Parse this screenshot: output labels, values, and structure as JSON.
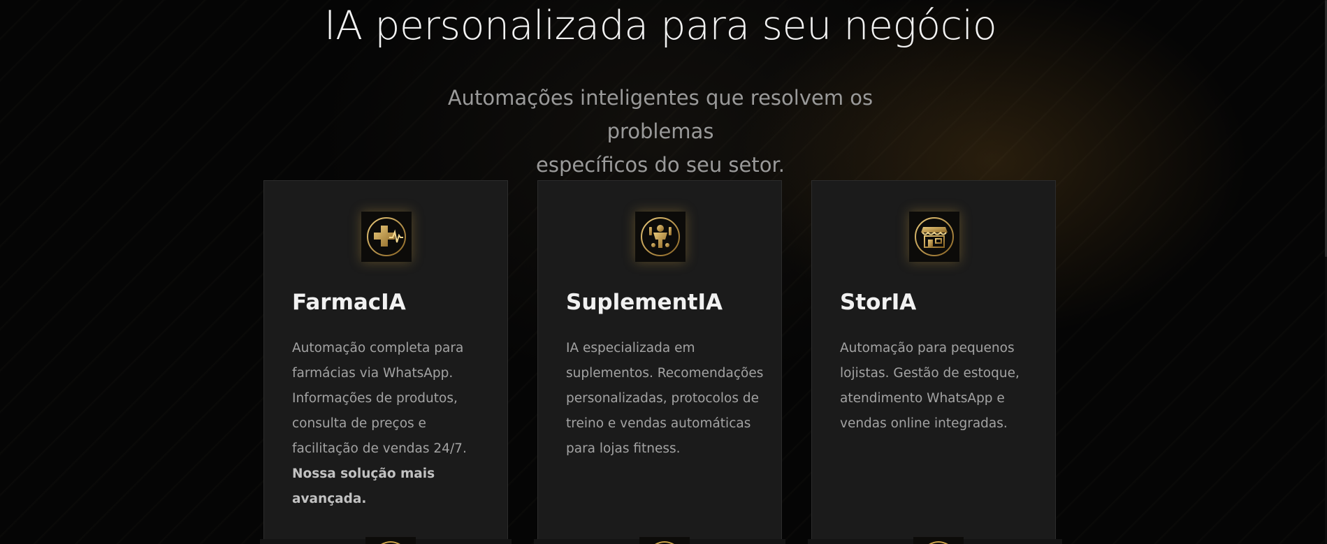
{
  "hero": {
    "title": "IA personalizada para seu negócio",
    "subtitle_line1": "Automações inteligentes que resolvem os problemas",
    "subtitle_line2": "específicos do seu setor."
  },
  "cards": [
    {
      "icon": "pharmacy-cross-icon",
      "name": "FarmacIA",
      "description": "Automação completa para farmácias via WhatsApp. Informações de produtos, consulta de preços e facilitação de vendas 24/7.",
      "highlight": "Nossa solução mais avançada."
    },
    {
      "icon": "fitness-athlete-icon",
      "name": "SuplementIA",
      "description": "IA especializada em suplementos. Recomendações personalizadas, protocolos de treino e vendas automáticas para lojas fitness."
    },
    {
      "icon": "storefront-icon",
      "name": "StorIA",
      "description": "Automação para pequenos lojistas. Gestão de estoque, atendimento WhatsApp e vendas online integradas."
    }
  ],
  "colors": {
    "accent_gold": "#c9a24a",
    "card_background": "#1b1b1b",
    "page_background": "#050505"
  }
}
